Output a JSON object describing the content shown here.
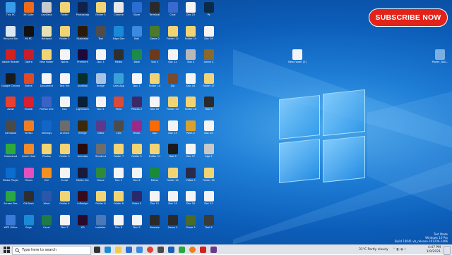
{
  "banner": {
    "label": "SUBSCRIBE NOW"
  },
  "watermark": {
    "line1": "Test Mode",
    "line2": "Windows 10 Pro",
    "line3": "Build 19041.vb_release.191206-1406"
  },
  "taskbar": {
    "search_placeholder": "Type here to search",
    "weather": "31°C  Partly cloudy",
    "time": "4:47 PM",
    "date": "1/9/2021"
  },
  "desktop_right_icons": [
    {
      "label": "New Folder (2)"
    },
    {
      "label": "Power_Tool..."
    }
  ],
  "desktop_icons": [
    {
      "label": "This PC",
      "color": "#3a9be8"
    },
    {
      "label": "Recycle Bin",
      "color": "#dbe7f2"
    },
    {
      "label": "Adobe Reader",
      "color": "#d32020"
    },
    {
      "label": "Google Chrome",
      "color": "#1a1a1a"
    },
    {
      "label": "Avast",
      "color": "#e8402f"
    },
    {
      "label": "Camtasia",
      "color": "#4a4a4a"
    },
    {
      "label": "Greenshot",
      "color": "#2eaa3d"
    },
    {
      "label": "Media Player",
      "color": "#0a6ccf"
    },
    {
      "label": "Screen Rec",
      "color": "#2aa642"
    },
    {
      "label": "WPS Office",
      "color": "#3a7ad8"
    },
    {
      "label": "Mi Suite",
      "color": "#f06a1a"
    },
    {
      "label": "Mi PC",
      "color": "#111111"
    },
    {
      "label": "Opera",
      "color": "#c81e2a"
    },
    {
      "label": "Brave",
      "color": "#e04a26"
    },
    {
      "label": "Vivaldi",
      "color": "#d81f2f"
    },
    {
      "label": "Firefox",
      "color": "#f07d20"
    },
    {
      "label": "Quick Heal",
      "color": "#f08a2a"
    },
    {
      "label": "iTunes",
      "color": "#e54fbe"
    },
    {
      "label": "Git Bash",
      "color": "#2e2e2e"
    },
    {
      "label": "Edge",
      "color": "#1a8ad8"
    },
    {
      "label": "AnyDesk",
      "color": "#c6c9cf"
    },
    {
      "label": "Notepad",
      "color": "#e7e2b4"
    },
    {
      "label": "New Folder",
      "color": "#f2d474"
    },
    {
      "label": "Document",
      "color": "#f4f4f4"
    },
    {
      "label": "Firefox Dev",
      "color": "#3b63c6"
    },
    {
      "label": "Settings",
      "color": "#1465c8"
    },
    {
      "label": "Photos",
      "color": "#f3d471"
    },
    {
      "label": "VLC",
      "color": "#f39020"
    },
    {
      "label": "Word",
      "color": "#2b57a8"
    },
    {
      "label": "Excel",
      "color": "#1e7a46"
    },
    {
      "label": "Folder",
      "color": "#f2d474"
    },
    {
      "label": "Folder 2",
      "color": "#f2d474"
    },
    {
      "label": "Notes",
      "color": "#f4f4f4"
    },
    {
      "label": "Text File",
      "color": "#f4f4f4"
    },
    {
      "label": "Doc",
      "color": "#f4f4f4"
    },
    {
      "label": "Archive",
      "color": "#6c6c6c"
    },
    {
      "label": "Folder 3",
      "color": "#f2d474"
    },
    {
      "label": "Script",
      "color": "#f4f4f4"
    },
    {
      "label": "Folder 4",
      "color": "#f2d474"
    },
    {
      "label": "Doc 2",
      "color": "#f4f4f4"
    },
    {
      "label": "Photoshop",
      "color": "#10214a"
    },
    {
      "label": "Illustrator",
      "color": "#2b1a08"
    },
    {
      "label": "Premiere",
      "color": "#1e0a3a"
    },
    {
      "label": "Audition",
      "color": "#07302a"
    },
    {
      "label": "Lightroom",
      "color": "#0a1f38"
    },
    {
      "label": "Bridge",
      "color": "#3a2a0a"
    },
    {
      "label": "Animate",
      "color": "#2b0a0a"
    },
    {
      "label": "Media Enc",
      "color": "#1a1a3a"
    },
    {
      "label": "InDesign",
      "color": "#3a0a1a"
    },
    {
      "label": "XD",
      "color": "#2a0a2a"
    },
    {
      "label": "Folder 5",
      "color": "#f2d474"
    },
    {
      "label": "Tool",
      "color": "#4d4d4d"
    },
    {
      "label": "Doc 3",
      "color": "#f4f4f4"
    },
    {
      "label": "Image",
      "color": "#a8c4e2"
    },
    {
      "label": "Doc 4",
      "color": "#f4f4f4"
    },
    {
      "label": "Video",
      "color": "#5a3a8a"
    },
    {
      "label": "Shortcut",
      "color": "#6d6d6d"
    },
    {
      "label": "Game",
      "color": "#2e8a3a"
    },
    {
      "label": "Folder 6",
      "color": "#f2d474"
    },
    {
      "label": "Installer",
      "color": "#4a78b8"
    },
    {
      "label": "Chrome",
      "color": "#e8e8e8"
    },
    {
      "label": "Edge Dev",
      "color": "#1a8ad8"
    },
    {
      "label": "Media",
      "color": "#2f2f2f"
    },
    {
      "label": "Cam App",
      "color": "#3aa0d8"
    },
    {
      "label": "Paint",
      "color": "#d84a3a"
    },
    {
      "label": "Calc",
      "color": "#4c4c4c"
    },
    {
      "label": "Folder 7",
      "color": "#f2d474"
    },
    {
      "label": "Doc 5",
      "color": "#f4f4f4"
    },
    {
      "label": "Folder 8",
      "color": "#f2d474"
    },
    {
      "label": "Doc 6",
      "color": "#f4f4f4"
    },
    {
      "label": "Store",
      "color": "#2a6ed2"
    },
    {
      "label": "Mail",
      "color": "#3a8ae0"
    },
    {
      "label": "Table",
      "color": "#1e8a4a"
    },
    {
      "label": "Doc 7",
      "color": "#f4f4f4"
    },
    {
      "label": "Photos 2",
      "color": "#3a2a6a"
    },
    {
      "label": "Music",
      "color": "#9a2a8a"
    },
    {
      "label": "Folder 9",
      "color": "#f2d474"
    },
    {
      "label": "Doc 8",
      "color": "#f4f4f4"
    },
    {
      "label": "Video 2",
      "color": "#2a2a6a"
    },
    {
      "label": "Doc 9",
      "color": "#f4f4f4"
    },
    {
      "label": "Terminal",
      "color": "#2a2a2a"
    },
    {
      "label": "Game 2",
      "color": "#4a7a2a"
    },
    {
      "label": "Tool 2",
      "color": "#6a3a1a"
    },
    {
      "label": "Folder 10",
      "color": "#f2d474"
    },
    {
      "label": "Doc 10",
      "color": "#f4f4f4"
    },
    {
      "label": "App",
      "color": "#ff6a00"
    },
    {
      "label": "Folder 11",
      "color": "#f2d474"
    },
    {
      "label": "Editor",
      "color": "#1a8a3a"
    },
    {
      "label": "Doc 11",
      "color": "#f4f4f4"
    },
    {
      "label": "Remote",
      "color": "#2a2a2a"
    },
    {
      "label": "Chat",
      "color": "#3a6ad0"
    },
    {
      "label": "Folder 12",
      "color": "#f2d474"
    },
    {
      "label": "Doc 12",
      "color": "#f4f4f4"
    },
    {
      "label": "Zip",
      "color": "#7a4a2a"
    },
    {
      "label": "Folder 13",
      "color": "#f2d474"
    },
    {
      "label": "Doc 13",
      "color": "#f4f4f4"
    },
    {
      "label": "Tool 3",
      "color": "#1a1a1a"
    },
    {
      "label": "Folder 14",
      "color": "#f2d474"
    },
    {
      "label": "Doc 14",
      "color": "#f4f4f4"
    },
    {
      "label": "Game 3",
      "color": "#2a2a2a"
    },
    {
      "label": "Doc 15",
      "color": "#f4f4f4"
    },
    {
      "label": "Folder 15",
      "color": "#f2d474"
    },
    {
      "label": "Tool 4",
      "color": "#b8b8b8"
    },
    {
      "label": "Doc 16",
      "color": "#f4f4f4"
    },
    {
      "label": "Folder 16",
      "color": "#f2d474"
    },
    {
      "label": "Paint 2",
      "color": "#d8a030"
    },
    {
      "label": "Doc 17",
      "color": "#f4f4f4"
    },
    {
      "label": "Video 3",
      "color": "#2a2a4a"
    },
    {
      "label": "Doc 18",
      "color": "#f4f4f4"
    },
    {
      "label": "Photo 3",
      "color": "#4a6a2a"
    },
    {
      "label": "Ps",
      "color": "#0a2a4a"
    },
    {
      "label": "Doc 19",
      "color": "#f4f4f4"
    },
    {
      "label": "Game 4",
      "color": "#8a6a2a"
    },
    {
      "label": "Folder 17",
      "color": "#f2d474"
    },
    {
      "label": "Tool 5",
      "color": "#2a2a2a"
    },
    {
      "label": "Doc 20",
      "color": "#f4f4f4"
    },
    {
      "label": "App 2",
      "color": "#c8c8c8"
    },
    {
      "label": "Folder 18",
      "color": "#f2d474"
    },
    {
      "label": "Doc 21",
      "color": "#f4f4f4"
    },
    {
      "label": "Tool 6",
      "color": "#3a3a3a"
    }
  ]
}
